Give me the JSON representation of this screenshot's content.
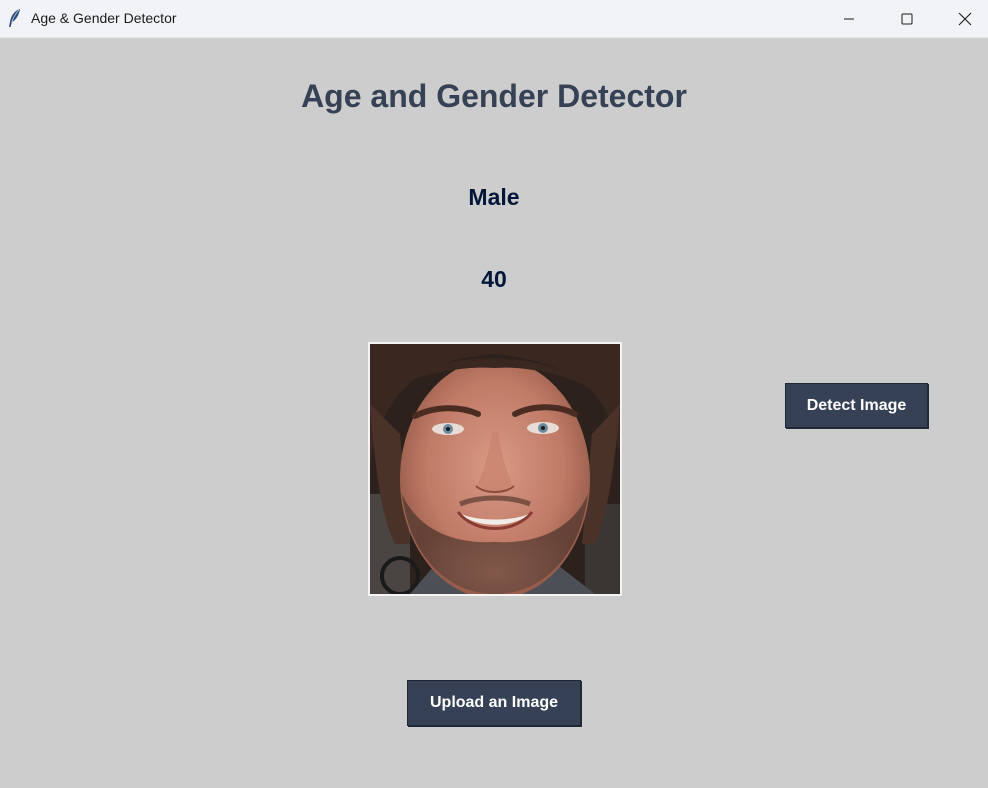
{
  "window": {
    "title": "Age & Gender Detector",
    "icon": "feather-icon",
    "controls": [
      "minimize-icon",
      "maximize-icon",
      "close-icon"
    ]
  },
  "main": {
    "heading": "Age and Gender Detector",
    "gender_result": "Male",
    "age_result": "40",
    "detect_button_label": "Detect Image",
    "upload_button_label": "Upload an Image"
  },
  "colors": {
    "background": "#cdcdcd",
    "heading": "#364156",
    "result_text": "#011638",
    "button_bg": "#364156",
    "button_text": "#ffffff"
  }
}
